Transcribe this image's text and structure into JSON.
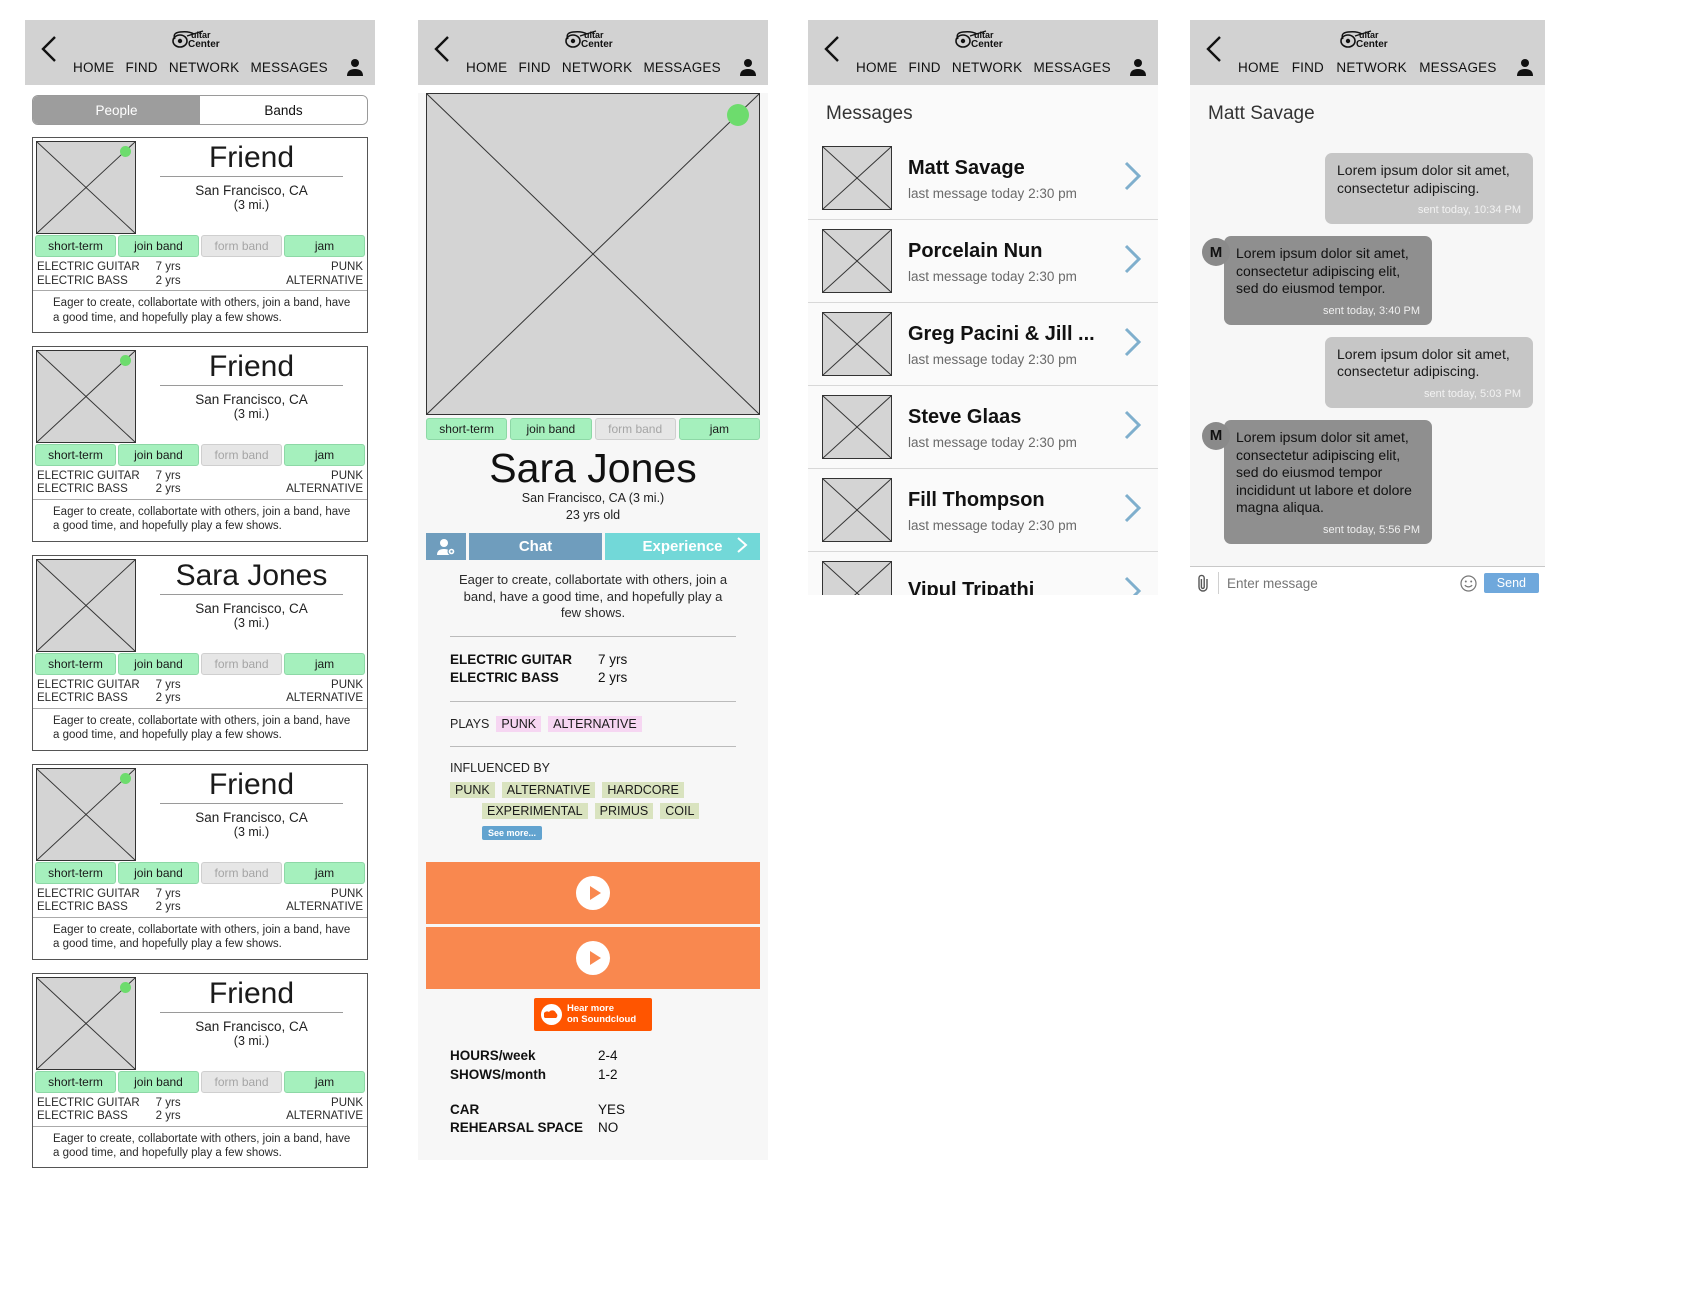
{
  "nav": {
    "back_icon": "chevron-left-icon",
    "logo_text": "Guitar Center",
    "logo_line1": "uitar",
    "logo_line2": "Center",
    "items": [
      "HOME",
      "FIND",
      "NETWORK",
      "MESSAGES"
    ],
    "avatar_icon": "person-icon"
  },
  "browse": {
    "segments": [
      {
        "label": "People",
        "active": true
      },
      {
        "label": "Bands",
        "active": false
      }
    ],
    "cards": [
      {
        "name": "Friend",
        "city": "San Francisco, CA",
        "distance": "(3 mi.)",
        "online": true,
        "tags": [
          {
            "label": "short-term",
            "on": true
          },
          {
            "label": "join band",
            "on": true
          },
          {
            "label": "form band",
            "on": false
          },
          {
            "label": "jam",
            "on": true
          }
        ],
        "instruments": [
          {
            "name": "ELECTRIC GUITAR",
            "years": "7 yrs"
          },
          {
            "name": "ELECTRIC BASS",
            "years": "2 yrs"
          }
        ],
        "genres": [
          "PUNK",
          "ALTERNATIVE"
        ],
        "bio": "Eager to create, collabortate with others, join a band, have a good time, and hopefully play a few shows."
      },
      {
        "name": "Friend",
        "city": "San Francisco, CA",
        "distance": "(3 mi.)",
        "online": true,
        "tags": [
          {
            "label": "short-term",
            "on": true
          },
          {
            "label": "join band",
            "on": true
          },
          {
            "label": "form band",
            "on": false
          },
          {
            "label": "jam",
            "on": true
          }
        ],
        "instruments": [
          {
            "name": "ELECTRIC GUITAR",
            "years": "7 yrs"
          },
          {
            "name": "ELECTRIC BASS",
            "years": "2 yrs"
          }
        ],
        "genres": [
          "PUNK",
          "ALTERNATIVE"
        ],
        "bio": "Eager to create, collabortate with others, join a band, have a good time, and hopefully play a few shows."
      },
      {
        "name": "Sara Jones",
        "city": "San Francisco, CA",
        "distance": "(3 mi.)",
        "online": false,
        "tags": [
          {
            "label": "short-term",
            "on": true
          },
          {
            "label": "join band",
            "on": true
          },
          {
            "label": "form band",
            "on": false
          },
          {
            "label": "jam",
            "on": true
          }
        ],
        "instruments": [
          {
            "name": "ELECTRIC GUITAR",
            "years": "7 yrs"
          },
          {
            "name": "ELECTRIC BASS",
            "years": "2 yrs"
          }
        ],
        "genres": [
          "PUNK",
          "ALTERNATIVE"
        ],
        "bio": "Eager to create, collabortate with others, join a band, have a good time, and hopefully play a few shows."
      },
      {
        "name": "Friend",
        "city": "San Francisco, CA",
        "distance": "(3 mi.)",
        "online": true,
        "tags": [
          {
            "label": "short-term",
            "on": true
          },
          {
            "label": "join band",
            "on": true
          },
          {
            "label": "form band",
            "on": false
          },
          {
            "label": "jam",
            "on": true
          }
        ],
        "instruments": [
          {
            "name": "ELECTRIC GUITAR",
            "years": "7 yrs"
          },
          {
            "name": "ELECTRIC BASS",
            "years": "2 yrs"
          }
        ],
        "genres": [
          "PUNK",
          "ALTERNATIVE"
        ],
        "bio": "Eager to create, collabortate with others, join a band, have a good time, and hopefully play a few shows."
      },
      {
        "name": "Friend",
        "city": "San Francisco, CA",
        "distance": "(3 mi.)",
        "online": true,
        "tags": [
          {
            "label": "short-term",
            "on": true
          },
          {
            "label": "join band",
            "on": true
          },
          {
            "label": "form band",
            "on": false
          },
          {
            "label": "jam",
            "on": true
          }
        ],
        "instruments": [
          {
            "name": "ELECTRIC GUITAR",
            "years": "7 yrs"
          },
          {
            "name": "ELECTRIC BASS",
            "years": "2 yrs"
          }
        ],
        "genres": [
          "PUNK",
          "ALTERNATIVE"
        ],
        "bio": "Eager to create, collabortate with others, join a band, have a good time, and hopefully play a few shows."
      }
    ]
  },
  "profile": {
    "online": true,
    "tags": [
      {
        "label": "short-term",
        "on": true
      },
      {
        "label": "join band",
        "on": true
      },
      {
        "label": "form band",
        "on": false
      },
      {
        "label": "jam",
        "on": true
      }
    ],
    "name": "Sara Jones",
    "city_distance": "San Francisco, CA  (3 mi.)",
    "age": "23 yrs old",
    "actions": {
      "add_icon": "add-person-icon",
      "chat": "Chat",
      "experience": "Experience",
      "experience_chevron": "chevron-right-icon"
    },
    "bio": "Eager to create, collabortate with others, join a band, have a good time, and hopefully play a few shows.",
    "instruments": [
      {
        "name": "ELECTRIC GUITAR",
        "years": "7 yrs"
      },
      {
        "name": "ELECTRIC BASS",
        "years": "2 yrs"
      }
    ],
    "plays_label": "PLAYS",
    "plays": [
      "PUNK",
      "ALTERNATIVE"
    ],
    "influenced_label": "INFLUENCED BY",
    "influenced_row1": [
      "PUNK",
      "ALTERNATIVE",
      "HARDCORE"
    ],
    "influenced_row2": [
      "EXPERIMENTAL",
      "PRIMUS",
      "COIL"
    ],
    "see_more": "See more...",
    "audio_tracks": [
      {
        "play_icon": "play-icon"
      },
      {
        "play_icon": "play-icon"
      }
    ],
    "soundcloud": {
      "icon": "soundcloud-cloud-icon",
      "line1": "Hear more",
      "line2": "on Soundcloud"
    },
    "stats": [
      {
        "key": "HOURS/week",
        "value": "2-4"
      },
      {
        "key": "SHOWS/month",
        "value": "1-2"
      },
      {
        "key": "CAR",
        "value": "YES"
      },
      {
        "key": "REHEARSAL SPACE",
        "value": "NO"
      }
    ]
  },
  "messages": {
    "title": "Messages",
    "items": [
      {
        "name": "Matt Savage",
        "last": "last message today 2:30 pm"
      },
      {
        "name": "Porcelain Nun",
        "last": "last message today 2:30 pm"
      },
      {
        "name": "Greg Pacini & Jill ...",
        "last": "last message today 2:30 pm"
      },
      {
        "name": "Steve Glaas",
        "last": "last message today 2:30 pm"
      },
      {
        "name": "Fill Thompson",
        "last": "last message today 2:30 pm"
      },
      {
        "name": "Vipul Tripathi",
        "last": ""
      }
    ],
    "chevron_icon": "chevron-right-icon"
  },
  "chat": {
    "title": "Matt Savage",
    "avatar_initial": "M",
    "bubbles": [
      {
        "dir": "out",
        "text": "Lorem ipsum dolor sit amet, consectetur adipiscing.",
        "stamp": "sent today, 10:34 PM"
      },
      {
        "dir": "in",
        "text": "Lorem ipsum dolor sit amet, consectetur adipiscing elit, sed do eiusmod tempor.",
        "stamp": "sent today, 3:40 PM"
      },
      {
        "dir": "out",
        "text": "Lorem ipsum dolor sit amet, consectetur adipiscing.",
        "stamp": "sent today, 5:03 PM"
      },
      {
        "dir": "in",
        "text": "Lorem ipsum dolor sit amet, consectetur adipiscing elit, sed do eiusmod tempor incididunt ut labore et dolore magna aliqua.",
        "stamp": "sent today, 5:56 PM"
      }
    ],
    "input": {
      "attach_icon": "paperclip-icon",
      "placeholder": "Enter message",
      "value": "",
      "emoji_icon": "smiley-icon",
      "send_label": "Send"
    }
  },
  "colors": {
    "navbar": "#d2d2d2",
    "tag_on": "#a5f0bd",
    "tag_off": "#e6e6e6",
    "accent_blue": "#6f9dbd",
    "accent_teal": "#72d8d8",
    "audio_orange": "#f9884f",
    "soundcloud_orange": "#ff5500",
    "online_green": "#6ddc6d",
    "chip_pink": "#f6d6f2",
    "chip_green": "#d9e3bf"
  }
}
